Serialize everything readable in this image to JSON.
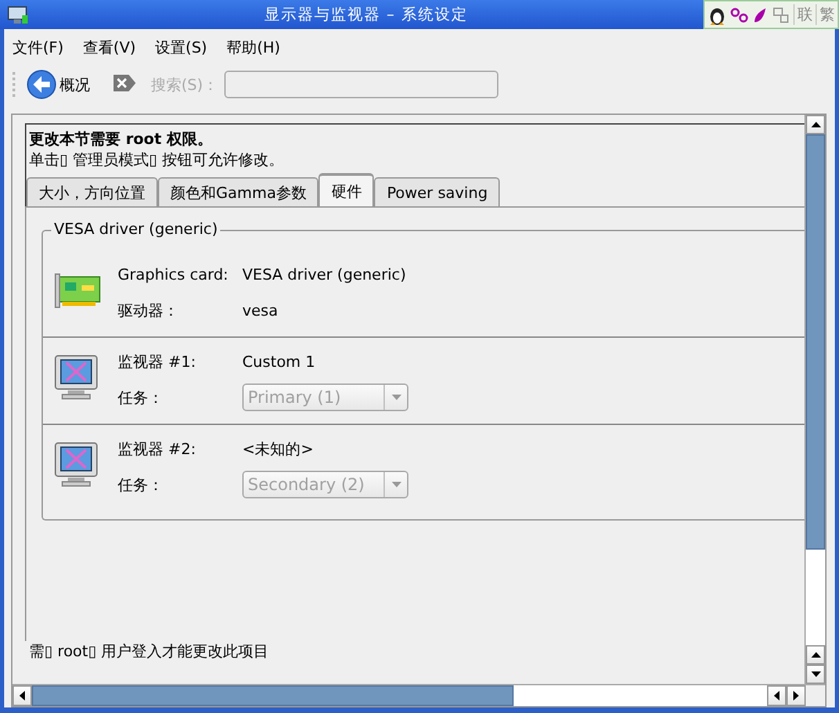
{
  "window": {
    "title": "显示器与监视器 – 系统设定"
  },
  "input_toolbar": {
    "keys": [
      "联",
      "繁"
    ]
  },
  "menu": [
    "文件(F)",
    "查看(V)",
    "设置(S)",
    "帮助(H)"
  ],
  "toolbar": {
    "overview": "概况",
    "search_label": "搜索(S)：",
    "search_disabled": true
  },
  "notice": {
    "title": "更改本节需要 root 权限。",
    "text": "单击▯ 管理员模式▯ 按钮可允许修改。"
  },
  "tabs": [
    {
      "label": "大小，方向位置",
      "selected": false
    },
    {
      "label": "颜色和Gamma参数",
      "selected": false
    },
    {
      "label": "硬件",
      "selected": true
    },
    {
      "label": "Power saving",
      "selected": false
    }
  ],
  "group": {
    "title": "VESA driver (generic)",
    "card": {
      "label": "Graphics card:",
      "value": "VESA driver (generic)",
      "driver_label": "驱动器：",
      "driver": "vesa"
    },
    "monitors": [
      {
        "label": "监视器 #1:",
        "value": "Custom 1",
        "role_label": "任务：",
        "role": "Primary (1)",
        "disabled": true
      },
      {
        "label": "监视器 #2:",
        "value": "<未知的>",
        "role_label": "任务：",
        "role": "Secondary (2)",
        "disabled": true
      }
    ]
  },
  "footer_note": "需▯ root▯ 用户登入才能更改此项目"
}
